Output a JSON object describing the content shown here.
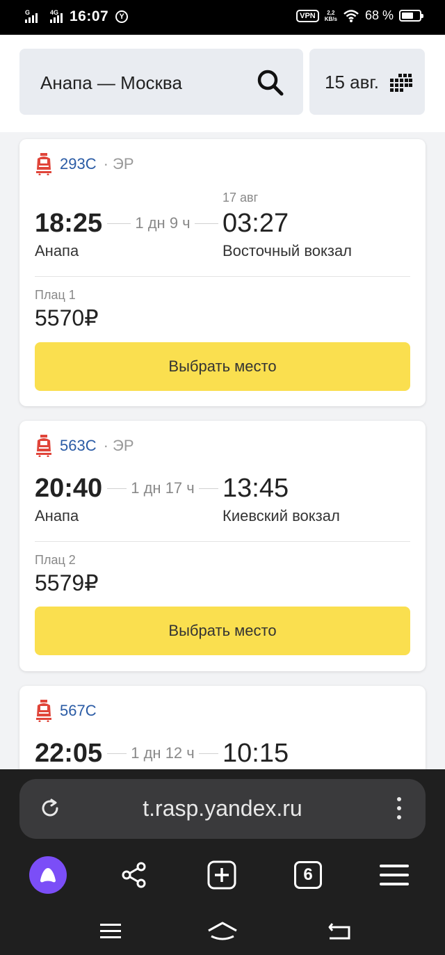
{
  "status_bar": {
    "network_1": "G",
    "network_2": "4G",
    "time": "16:07",
    "app_badge": "Y",
    "vpn": "VPN",
    "speed_value": "2,2",
    "speed_unit": "KB/s",
    "battery_text": "68 %",
    "battery_level": 0.68
  },
  "search": {
    "route": "Анапа — Москва",
    "date": "15 авг."
  },
  "trains": [
    {
      "number": "293С",
      "type": "· ЭР",
      "dep_time": "18:25",
      "duration": "1 дн 9 ч",
      "arr_date": "17 авг",
      "arr_time": "03:27",
      "dep_station": "Анапа",
      "arr_station": "Восточный вокзал",
      "seat_class": "Плац 1",
      "price": "5570₽",
      "button": "Выбрать место"
    },
    {
      "number": "563С",
      "type": "· ЭР",
      "dep_time": "20:40",
      "duration": "1 дн 17 ч",
      "arr_date": "",
      "arr_time": "13:45",
      "dep_station": "Анапа",
      "arr_station": "Киевский вокзал",
      "seat_class": "Плац 2",
      "price": "5579₽",
      "button": "Выбрать место"
    },
    {
      "number": "567С",
      "type": "",
      "dep_time": "22:05",
      "duration": "1 дн 12 ч",
      "arr_time": "10:15"
    }
  ],
  "browser": {
    "url": "t.rasp.yandex.ru",
    "tabs_count": "6"
  },
  "colors": {
    "accent_yellow": "#fadf4f",
    "train_number_blue": "#2a5ba5",
    "train_icon_red": "#e0453a",
    "alice_purple": "#7b4ef7"
  }
}
